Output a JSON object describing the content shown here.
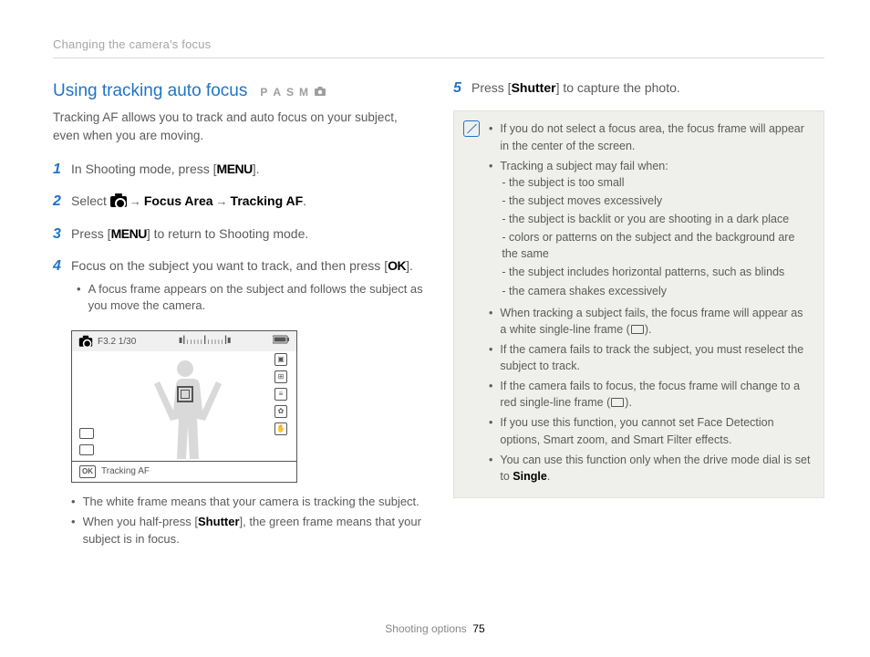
{
  "header": "Changing the camera's focus",
  "title": "Using tracking auto focus",
  "modes": [
    "P",
    "A",
    "S",
    "M"
  ],
  "intro": "Tracking AF allows you to track and auto focus on your subject, even when you are moving.",
  "steps": {
    "s1_a": "In Shooting mode, press [",
    "s1_menu": "MENU",
    "s1_b": "].",
    "s2_a": "Select ",
    "s2_fa": "Focus Area",
    "s2_taf": "Tracking AF",
    "s2_end": ".",
    "s3_a": "Press [",
    "s3_menu": "MENU",
    "s3_b": "] to return to Shooting mode.",
    "s4_a": "Focus on the subject you want to track, and then press [",
    "s4_ok": "OK",
    "s4_b": "].",
    "s4_sub": "A focus frame appears on the subject and follows the subject as you move the camera.",
    "s5_a": "Press [",
    "s5_shutter": "Shutter",
    "s5_b": "] to capture the photo."
  },
  "screenshot": {
    "exposure": "F3.2 1/30",
    "bottom_label": "Tracking AF",
    "bottom_btn": "OK"
  },
  "after_ss": {
    "b1": "The white frame means that your camera is tracking the subject.",
    "b2_a": "When you half-press [",
    "b2_shutter": "Shutter",
    "b2_b": "], the green frame means that your subject is in focus."
  },
  "notes": {
    "n1": "If you do not select a focus area, the focus frame will appear in the center of the screen.",
    "n2": "Tracking a subject may fail when:",
    "n2d": [
      "the subject is too small",
      "the subject moves excessively",
      "the subject is backlit or you are shooting in a dark place",
      "colors or patterns on the subject and the background are the same",
      "the subject includes horizontal patterns, such as blinds",
      "the camera shakes excessively"
    ],
    "n3_a": "When tracking a subject fails, the focus frame will appear as a white single-line frame (",
    "n3_b": ").",
    "n4": "If the camera fails to track the subject, you must reselect the subject to track.",
    "n5_a": "If the camera fails to focus, the focus frame will change to a red single-line frame (",
    "n5_b": ").",
    "n6": "If you use this function, you cannot set Face Detection options, Smart zoom, and Smart Filter effects.",
    "n7_a": "You can use this function only when the drive mode dial is set to ",
    "n7_single": "Single",
    "n7_b": "."
  },
  "footer": {
    "section": "Shooting options",
    "page": "75"
  }
}
